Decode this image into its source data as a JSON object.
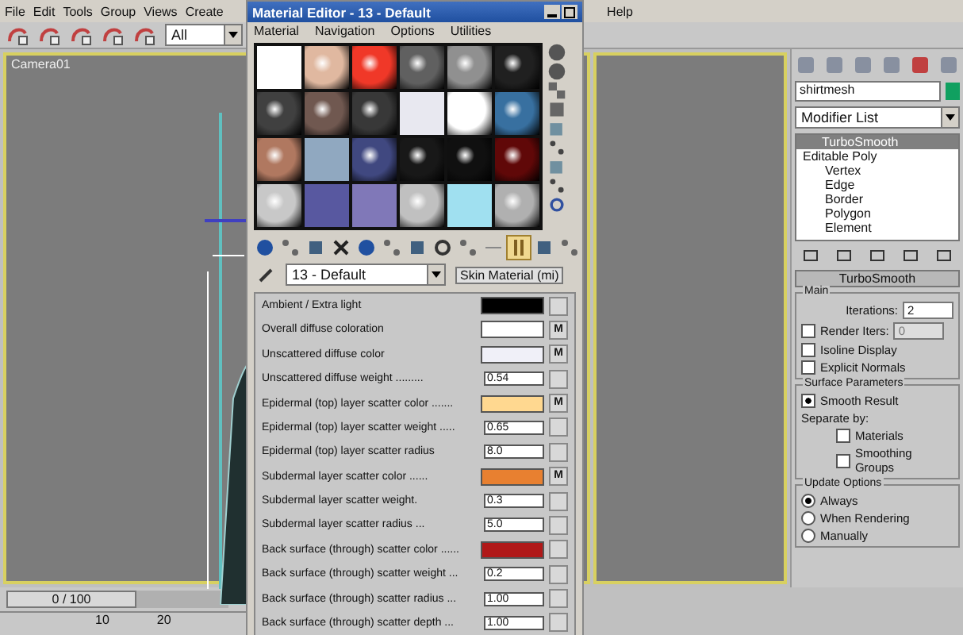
{
  "menu_bar": [
    "File",
    "Edit",
    "Tools",
    "Group",
    "Views",
    "Create",
    "Help"
  ],
  "toolbar": {
    "selection_filter": "All"
  },
  "viewport": {
    "label": "Camera01"
  },
  "timeline": {
    "frame": "0 / 100",
    "level": 0,
    "ticks": [
      "10",
      "20"
    ]
  },
  "material_editor": {
    "title": "Material Editor - 13 - Default",
    "menu": [
      "Material",
      "Navigation",
      "Options",
      "Utilities"
    ],
    "slots": [
      {
        "kind": "flat",
        "color": "#ffffff"
      },
      {
        "kind": "sphere",
        "color": "#e0b8a0"
      },
      {
        "kind": "sphere",
        "color": "#f03828"
      },
      {
        "kind": "sphere",
        "color": "#606060"
      },
      {
        "kind": "sphere",
        "color": "#909090"
      },
      {
        "kind": "sphere",
        "color": "#202020"
      },
      {
        "kind": "sphere",
        "color": "#404040"
      },
      {
        "kind": "sphere",
        "color": "#705850"
      },
      {
        "kind": "sphere",
        "color": "#383838"
      },
      {
        "kind": "flat",
        "color": "#e8e8f0"
      },
      {
        "kind": "sphere",
        "color": "#ffffff"
      },
      {
        "kind": "sphere",
        "color": "#3870a0"
      },
      {
        "kind": "sphere",
        "color": "#b07860"
      },
      {
        "kind": "flat",
        "color": "#90a8c0"
      },
      {
        "kind": "sphere",
        "color": "#404880"
      },
      {
        "kind": "sphere",
        "color": "#181818"
      },
      {
        "kind": "sphere",
        "color": "#101010"
      },
      {
        "kind": "sphere",
        "color": "#600808"
      },
      {
        "kind": "sphere",
        "color": "#c8c8c8"
      },
      {
        "kind": "flat",
        "color": "#5858a0"
      },
      {
        "kind": "flat",
        "color": "#8078b8"
      },
      {
        "kind": "sphere",
        "color": "#c0c0c0"
      },
      {
        "kind": "flat",
        "color": "#a0e0f0"
      },
      {
        "kind": "sphere",
        "color": "#b0b0b0"
      }
    ],
    "tools": [
      {
        "selected": false
      },
      {
        "selected": false
      },
      {
        "selected": false
      },
      {
        "selected": false
      },
      {
        "selected": false
      },
      {
        "selected": false
      },
      {
        "selected": false
      },
      {
        "selected": false
      },
      {
        "selected": false
      },
      {
        "selected": false
      },
      {
        "selected": true
      },
      {
        "selected": false
      },
      {
        "selected": false
      }
    ],
    "material_name": "13 - Default",
    "material_type": "Skin Material (mi)",
    "parameters": [
      {
        "kind": "color",
        "label": "Ambient / Extra light",
        "color": "#000000"
      },
      {
        "kind": "color",
        "label": "Overall diffuse coloration",
        "color": "#ffffff",
        "map": "M"
      },
      {
        "kind": "color",
        "label": "Unscattered diffuse color",
        "color": "#f0f0f8",
        "map": "M"
      },
      {
        "kind": "spinner",
        "label": "Unscattered diffuse weight .........",
        "value": "0.54"
      },
      {
        "kind": "color",
        "label": "Epidermal (top) layer scatter color .......",
        "color": "#ffd890",
        "map": "M"
      },
      {
        "kind": "spinner",
        "label": "Epidermal (top) layer scatter weight .....",
        "value": "0.65"
      },
      {
        "kind": "spinner",
        "label": "Epidermal (top) layer scatter radius",
        "value": "8.0"
      },
      {
        "kind": "color",
        "label": "Subdermal layer scatter color ......",
        "color": "#e88030",
        "map": "M"
      },
      {
        "kind": "spinner",
        "label": "Subdermal layer scatter weight.",
        "value": "0.3"
      },
      {
        "kind": "spinner",
        "label": "Subdermal layer scatter radius ...",
        "value": "5.0"
      },
      {
        "kind": "color",
        "label": "Back surface (through) scatter color ......",
        "color": "#b01818"
      },
      {
        "kind": "spinner",
        "label": "Back surface (through) scatter weight ...",
        "value": "0.2"
      },
      {
        "kind": "spinner",
        "label": "Back surface (through) scatter radius ...",
        "value": "1.00"
      },
      {
        "kind": "spinner",
        "label": "Back surface (through) scatter depth ...",
        "value": "1.00"
      }
    ]
  },
  "command_panel": {
    "object_name": "shirtmesh",
    "modifier_list": "Modifier List",
    "stack": [
      {
        "label": "TurboSmooth",
        "selected": true
      },
      {
        "label": "Editable Poly",
        "selected": false,
        "children": [
          {
            "label": "Vertex",
            "selected": false
          },
          {
            "label": "Edge",
            "selected": false
          },
          {
            "label": "Border",
            "selected": false
          },
          {
            "label": "Polygon",
            "selected": false
          },
          {
            "label": "Element",
            "selected": false
          }
        ]
      }
    ],
    "rollout_title": "TurboSmooth",
    "main_group": "Main",
    "iterations_label": "Iterations:",
    "iterations": "2",
    "render_iters": {
      "label": "Render Iters:",
      "checked": false,
      "value": "0"
    },
    "isoline": {
      "label": "Isoline Display",
      "checked": false
    },
    "explicit_normals": {
      "label": "Explicit Normals",
      "checked": false
    },
    "surface_group": "Surface Parameters",
    "smooth_result": {
      "label": "Smooth Result",
      "checked": true
    },
    "separate_by": "Separate by:",
    "materials": {
      "label": "Materials",
      "checked": false
    },
    "smoothing_groups": {
      "label": "Smoothing Groups",
      "checked": false
    },
    "update_group": "Update Options",
    "update_options": [
      {
        "label": "Always",
        "selected": true
      },
      {
        "label": "When Rendering",
        "selected": false
      },
      {
        "label": "Manually",
        "selected": false
      }
    ]
  }
}
